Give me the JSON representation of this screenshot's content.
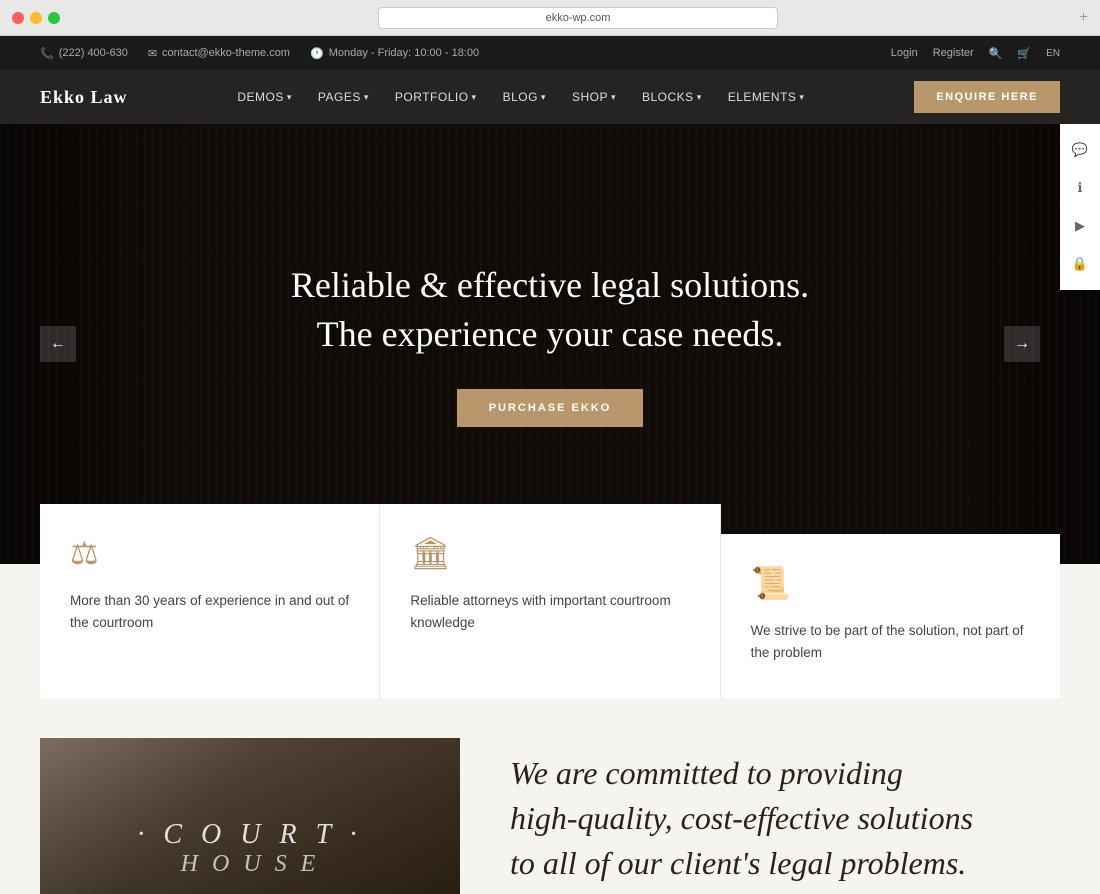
{
  "browser": {
    "url": "ekko-wp.com",
    "add_tab": "+"
  },
  "topbar": {
    "phone": "(222) 400-630",
    "email": "contact@ekko-theme.com",
    "hours": "Monday - Friday: 10:00 - 18:00",
    "login": "Login",
    "register": "Register",
    "language": "EN"
  },
  "nav": {
    "logo": "Ekko Law",
    "items": [
      {
        "label": "DEMOS",
        "has_dropdown": true
      },
      {
        "label": "PAGES",
        "has_dropdown": true
      },
      {
        "label": "PORTFOLIO",
        "has_dropdown": true
      },
      {
        "label": "BLOG",
        "has_dropdown": true
      },
      {
        "label": "SHOP",
        "has_dropdown": true
      },
      {
        "label": "BLOCKS",
        "has_dropdown": true
      },
      {
        "label": "ELEMENTS",
        "has_dropdown": true
      }
    ],
    "cta": "ENQUIRE HERE"
  },
  "hero": {
    "title_line1": "Reliable & effective legal solutions.",
    "title_line2": "The experience your case needs.",
    "button": "PURCHASE EKKO",
    "prev_arrow": "←",
    "next_arrow": "→"
  },
  "features": [
    {
      "icon": "⚖",
      "text": "More than 30 years of experience in and out of the courtroom"
    },
    {
      "icon": "🏛",
      "text": "Reliable attorneys with important courtroom knowledge"
    },
    {
      "icon": "📜",
      "text": "We strive to be part of the solution, not part of the problem"
    }
  ],
  "commitment": {
    "image_text_top": "· Court ·",
    "image_text_bottom": "House",
    "title_line1": "We are committed to providing",
    "title_line2": "high-quality, cost-effective solutions",
    "title_line3": "to all of our client's legal problems."
  },
  "side_panel": {
    "icons": [
      "💬",
      "ℹ",
      "▶",
      "🔒"
    ]
  }
}
